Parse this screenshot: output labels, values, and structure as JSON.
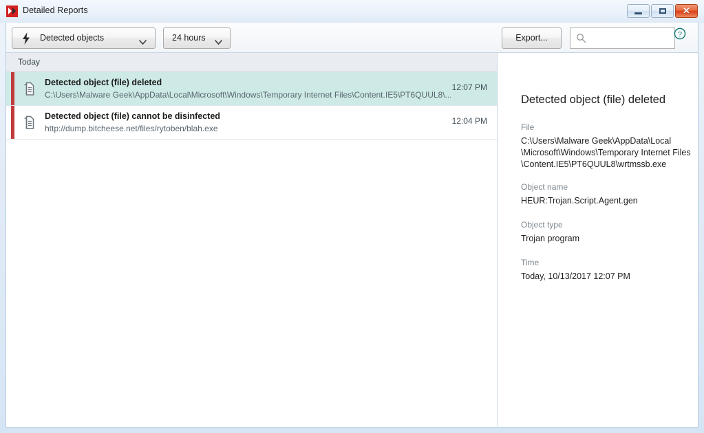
{
  "window": {
    "title": "Detailed Reports",
    "app_icon": "kaspersky-logo-icon",
    "controls": {
      "minimize": "minimize-icon",
      "maximize": "maximize-icon",
      "close": "✕"
    }
  },
  "toolbar": {
    "object_filter": {
      "icon": "lightning-bolt-icon",
      "label": "Detected objects",
      "chevron": "chevron-down-icon"
    },
    "period_filter": {
      "label": "24 hours",
      "chevron": "chevron-down-icon"
    },
    "export_label": "Export...",
    "search": {
      "icon": "search-icon",
      "value": "",
      "placeholder": ""
    },
    "help_icon": "help-circle-icon",
    "help_color": "#127c72"
  },
  "list": {
    "group_label": "Today",
    "rows": [
      {
        "icon": "document-stack-icon",
        "title": "Detected object (file) deleted",
        "subtitle": "C:\\Users\\Malware Geek\\AppData\\Local\\Microsoft\\Windows\\Temporary Internet Files\\Content.IE5\\PT6QUUL8\\...",
        "time": "12:07 PM",
        "selected": true,
        "marker_color": "#c23b3b"
      },
      {
        "icon": "document-stack-icon",
        "title": "Detected object (file) cannot be disinfected",
        "subtitle": "http://dump.bitcheese.net/files/rytoben/blah.exe",
        "time": "12:04 PM",
        "selected": false,
        "marker_color": "#c23b3b"
      }
    ]
  },
  "detail": {
    "title": "Detected object (file) deleted",
    "fields": [
      {
        "label": "File",
        "value": "C:\\Users\\Malware Geek\\AppData\\Local\n\\Microsoft\\Windows\\Temporary Internet Files\n\\Content.IE5\\PT6QUUL8\\wrtmssb.exe"
      },
      {
        "label": "Object name",
        "value": "HEUR:Trojan.Script.Agent.gen"
      },
      {
        "label": "Object type",
        "value": "Trojan program"
      },
      {
        "label": "Time",
        "value": "Today, 10/13/2017 12:07 PM"
      }
    ]
  }
}
